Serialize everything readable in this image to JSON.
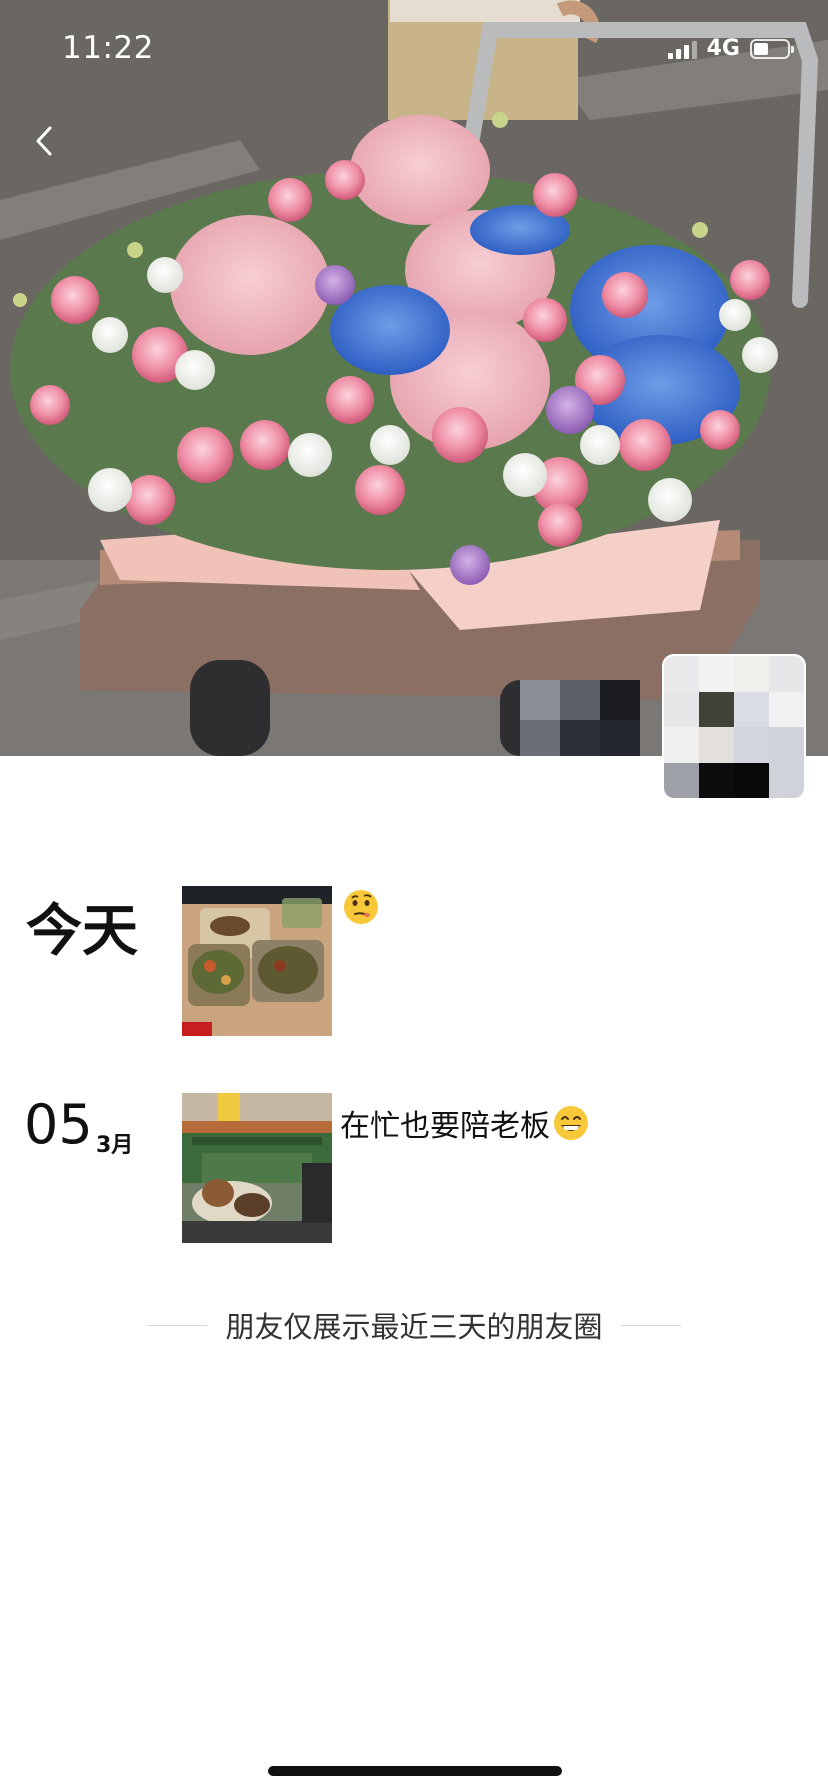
{
  "status_bar": {
    "time": "11:22",
    "network": "4G"
  },
  "header": {
    "back_icon": "chevron-left-icon"
  },
  "cover": {
    "description_icon": "flower-cart-photo"
  },
  "feed": {
    "posts": [
      {
        "date_label": "今天",
        "thumbnail": "food-containers-photo",
        "text": "",
        "emoji": "thinking-face-emoji"
      },
      {
        "day": "05",
        "month": "3月",
        "thumbnail": "street-dog-photo",
        "text": "在忙也要陪老板",
        "emoji": "grinning-face-emoji"
      }
    ]
  },
  "notice": {
    "text": "朋友仅展示最近三天的朋友圈"
  },
  "colors": {
    "background": "#ffffff",
    "text": "#111111",
    "divider": "#d8d8d8"
  }
}
